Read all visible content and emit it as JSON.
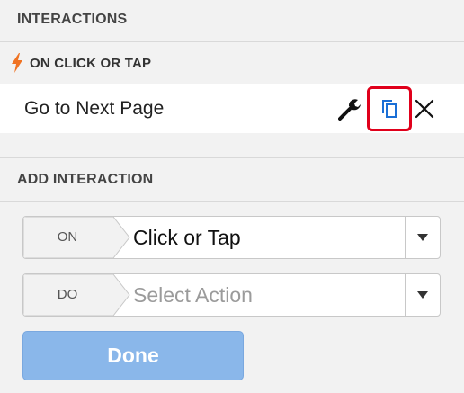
{
  "interactions_header": "INTERACTIONS",
  "event": {
    "label": "ON CLICK OR TAP",
    "icon": "lightning-bolt-icon",
    "icon_color": "#f07323"
  },
  "action": {
    "label": "Go to Next Page",
    "icons": [
      "wrench-icon",
      "copy-icon",
      "close-icon"
    ],
    "highlight_color": "#e0001b",
    "copy_icon_color": "#1a6fd6"
  },
  "add_interaction_header": "ADD INTERACTION",
  "on_select": {
    "tag": "ON",
    "value": "Click or Tap"
  },
  "do_select": {
    "tag": "DO",
    "placeholder": "Select Action"
  },
  "done_button": {
    "label": "Done",
    "color": "#8ab7ea"
  }
}
